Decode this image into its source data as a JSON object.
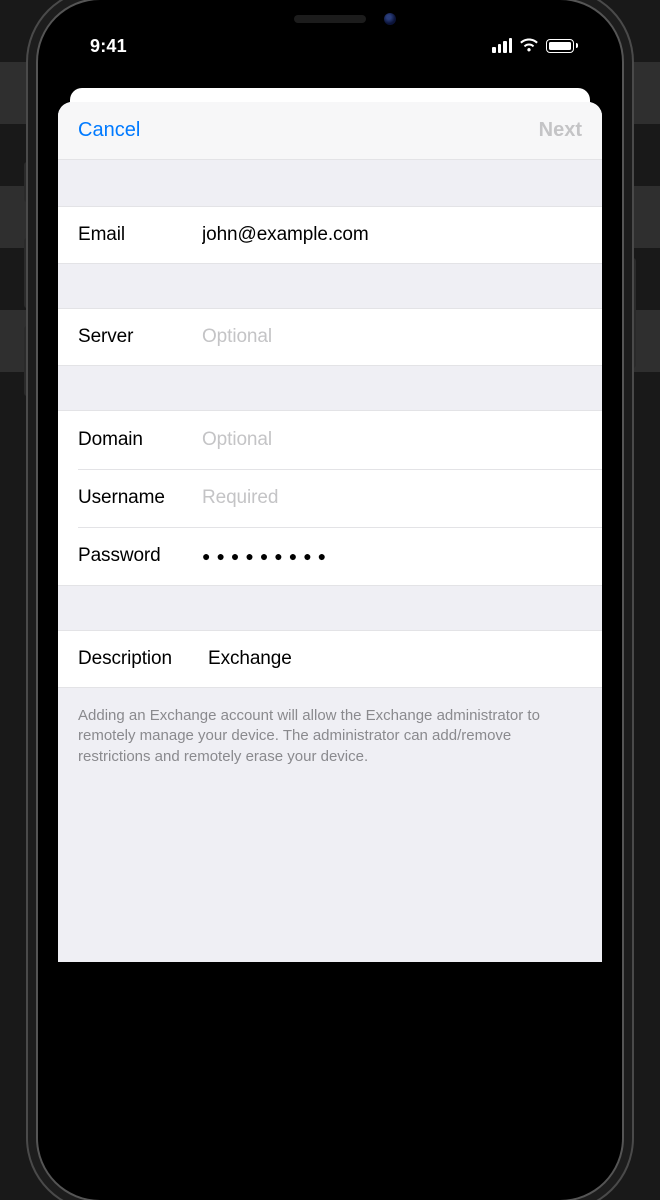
{
  "status": {
    "time": "9:41"
  },
  "nav": {
    "cancel": "Cancel",
    "next": "Next"
  },
  "fields": {
    "email": {
      "label": "Email",
      "value": "john@example.com"
    },
    "server": {
      "label": "Server",
      "placeholder": "Optional",
      "value": ""
    },
    "domain": {
      "label": "Domain",
      "placeholder": "Optional",
      "value": ""
    },
    "username": {
      "label": "Username",
      "placeholder": "Required",
      "value": ""
    },
    "password": {
      "label": "Password",
      "value": "●●●●●●●●●"
    },
    "description": {
      "label": "Description",
      "value": "Exchange"
    }
  },
  "footer": "Adding an Exchange account will allow the Exchange administrator to remotely manage your device. The administrator can add/remove restrictions and remotely erase your device."
}
